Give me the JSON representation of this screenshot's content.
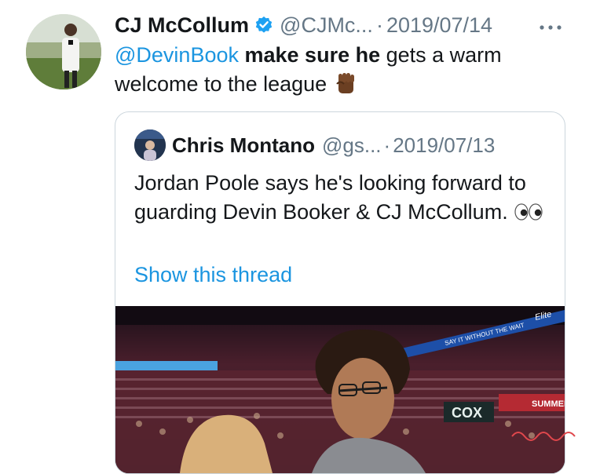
{
  "tweet": {
    "author_name": "CJ McCollum",
    "handle": "@CJMc...",
    "separator": "·",
    "date": "2019/07/14",
    "text": {
      "mention": "@DevinBook",
      "bold": "make sure he",
      "rest": " gets a warm welcome to the league"
    },
    "verified_icon": "verified-badge-icon",
    "more_icon": "more-dots-icon",
    "emoji": "raised-fist-icon"
  },
  "quoted_tweet": {
    "author_name": "Chris Montano",
    "handle": "@gs...",
    "separator": "·",
    "date": "2019/07/13",
    "text": "Jordan Poole says he's looking forward to guarding Devin Booker & CJ McCollum.",
    "emoji": "eyes-icon",
    "show_thread": "Show this thread",
    "media": {
      "ribbon_text": "SAY IT WITHOUT THE WAIT",
      "brand_text": "Elite",
      "sponsor_text": "COX",
      "banner_text": "SUMMER"
    }
  },
  "colors": {
    "link": "#1b95e0",
    "secondary_text": "#657786",
    "border": "#ccd6dd",
    "verified": "#1da1f2"
  }
}
